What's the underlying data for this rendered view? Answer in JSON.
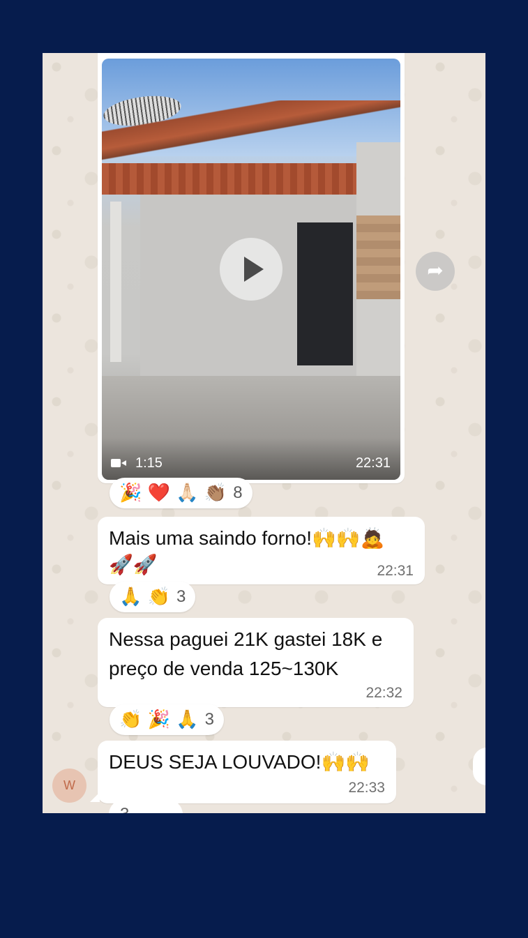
{
  "video_message": {
    "duration": "1:15",
    "time": "22:31",
    "icons": [
      "video-camera-icon",
      "play-icon",
      "forward-icon"
    ]
  },
  "reactions_1": {
    "emojis": "🎉 ❤️ 🙏🏻 👏🏽",
    "count": "8"
  },
  "message_1": {
    "text": "Mais uma saindo forno!🙌🙌🙇",
    "emoji_line": "🚀🚀",
    "time": "22:31"
  },
  "reactions_2": {
    "emojis": "🙏 👏",
    "count": "3"
  },
  "message_2": {
    "line1": "Nessa paguei 21K gastei 18K e",
    "line2": "preço de venda 125~130K",
    "time": "22:32"
  },
  "reactions_3": {
    "emojis": "👏 🎉 🙏",
    "count": "3"
  },
  "message_3": {
    "text": "DEUS SEJA LOUVADO!🙌🙌",
    "time": "22:33"
  },
  "avatar": {
    "initial": "W"
  },
  "reactions_4": {
    "count": "3"
  },
  "colors": {
    "background": "#061c4d",
    "chat_wallpaper": "#ece5dd",
    "bubble": "#ffffff"
  }
}
